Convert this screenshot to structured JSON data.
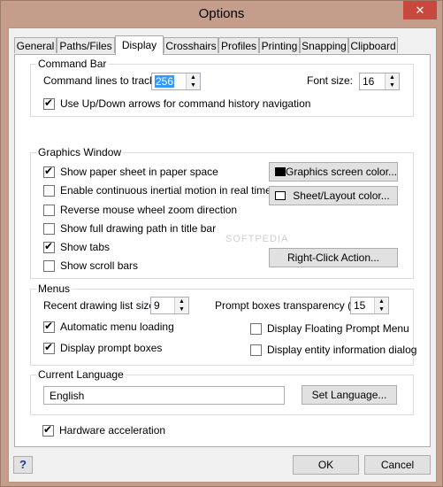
{
  "window": {
    "title": "Options",
    "close_glyph": "✕"
  },
  "tabs": [
    {
      "label": "General"
    },
    {
      "label": "Paths/Files"
    },
    {
      "label": "Display"
    },
    {
      "label": "Crosshairs"
    },
    {
      "label": "Profiles"
    },
    {
      "label": "Printing"
    },
    {
      "label": "Snapping"
    },
    {
      "label": "Clipboard"
    }
  ],
  "command_bar": {
    "title": "Command Bar",
    "lines_label": "Command lines to track:",
    "lines_value": "256",
    "font_label": "Font size:",
    "font_value": "16",
    "updown_label": "Use Up/Down arrows for command history navigation",
    "updown_checked": true
  },
  "graphics": {
    "title": "Graphics Window",
    "options": [
      {
        "label": "Show paper sheet in paper space",
        "checked": true
      },
      {
        "label": "Enable continuous inertial motion in real time",
        "checked": false
      },
      {
        "label": "Reverse mouse wheel zoom direction",
        "checked": false
      },
      {
        "label": "Show full drawing path in title bar",
        "checked": false
      },
      {
        "label": "Show tabs",
        "checked": true
      },
      {
        "label": "Show scroll bars",
        "checked": false
      }
    ],
    "screen_color_button": "Graphics screen color...",
    "screen_color": "#000000",
    "layout_color_button": "Sheet/Layout color...",
    "layout_color": "#ffffff",
    "right_click_button": "Right-Click Action..."
  },
  "menus": {
    "title": "Menus",
    "recent_label": "Recent drawing list size:",
    "recent_value": "9",
    "prompt_transparency_label": "Prompt boxes transparency (%):",
    "prompt_transparency_value": "15",
    "auto_menu_label": "Automatic menu loading",
    "auto_menu_checked": true,
    "display_prompt_label": "Display prompt boxes",
    "display_prompt_checked": true,
    "floating_prompt_label": "Display Floating Prompt Menu",
    "floating_prompt_checked": false,
    "entity_info_label": "Display entity information dialog",
    "entity_info_checked": false
  },
  "language": {
    "title": "Current Language",
    "value": "English",
    "set_button": "Set Language..."
  },
  "hardware": {
    "label": "Hardware acceleration",
    "checked": true
  },
  "footer": {
    "help": "?",
    "ok": "OK",
    "cancel": "Cancel"
  },
  "watermark": "SOFTPEDIA"
}
